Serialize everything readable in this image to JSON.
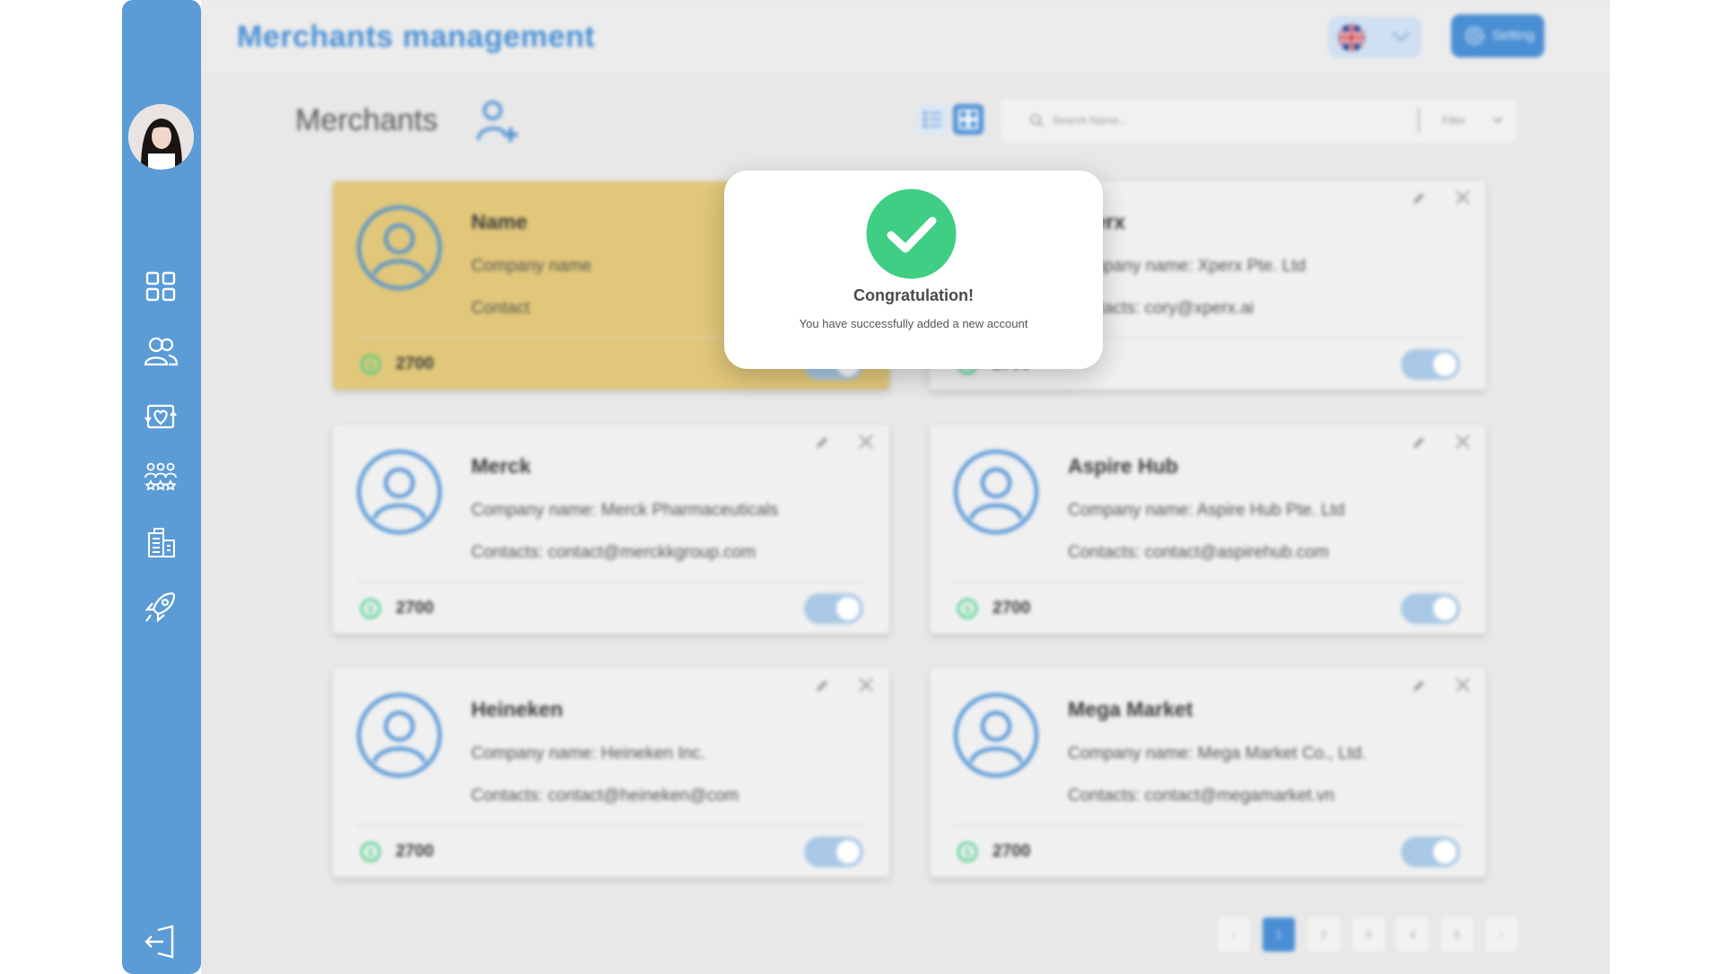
{
  "header": {
    "title": "Merchants management",
    "setting_label": "Setting",
    "language_flag": "uk-flag-icon"
  },
  "sidebar": {
    "items": [
      {
        "icon": "dashboard-grid-icon"
      },
      {
        "icon": "users-icon"
      },
      {
        "icon": "loyalty-exchange-icon"
      },
      {
        "icon": "groups-rating-icon"
      },
      {
        "icon": "receipt-building-icon"
      },
      {
        "icon": "rocket-icon"
      }
    ],
    "logout_icon": "logout-icon"
  },
  "main": {
    "title": "Merchants",
    "search_placeholder": "Search Name...",
    "filter_label": "Filter"
  },
  "merchants": [
    {
      "name": "Name",
      "company": "Company name",
      "contact": "Contact",
      "points": "2700",
      "highlighted": true,
      "enabled": true
    },
    {
      "name": "Xperx",
      "company": "Company name: Xperx Pte. Ltd",
      "contact": "Contacts: cory@xperx.ai",
      "points": "2700",
      "highlighted": false,
      "enabled": true
    },
    {
      "name": "Merck",
      "company": "Company name: Merck Pharmaceuticals",
      "contact": "Contacts: contact@merckkgroup.com",
      "points": "2700",
      "highlighted": false,
      "enabled": true
    },
    {
      "name": "Aspire Hub",
      "company": "Company name: Aspire Hub Pte. Ltd",
      "contact": "Contacts: contact@aspirehub.com",
      "points": "2700",
      "highlighted": false,
      "enabled": true
    },
    {
      "name": "Heineken",
      "company": "Company name: Heineken Inc.",
      "contact": "Contacts: contact@heineken@com",
      "points": "2700",
      "highlighted": false,
      "enabled": true
    },
    {
      "name": "Mega Market",
      "company": "Company name: Mega Market Co., Ltd.",
      "contact": "Contacts: contact@megamarket.vn",
      "points": "2700",
      "highlighted": false,
      "enabled": true
    }
  ],
  "pagination": {
    "pages": [
      "1",
      "2",
      "3",
      "4",
      "5"
    ],
    "current": "1"
  },
  "modal": {
    "title": "Congratulation!",
    "message": "You have successfully added a new account"
  },
  "colors": {
    "primary": "#4a8fd4",
    "sidebar": "#5b9bd6",
    "highlight_card": "#e1c77a",
    "success": "#3ecf85"
  }
}
